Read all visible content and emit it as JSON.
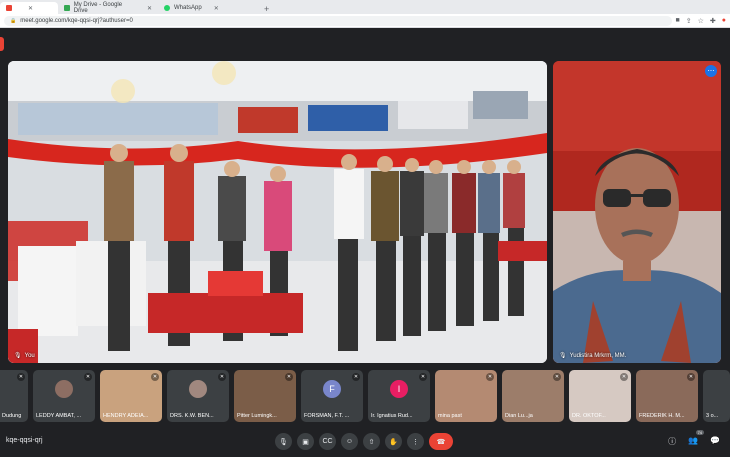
{
  "browser": {
    "tabs": [
      {
        "label": "",
        "active": true,
        "fav_color": "#ea4335"
      },
      {
        "label": "My Drive - Google Drive",
        "active": false,
        "fav_color": "#34a853"
      },
      {
        "label": "WhatsApp",
        "active": false,
        "fav_color": "#25d366"
      }
    ],
    "url": "meet.google.com/kqe-qqsi-qrj?authuser=0"
  },
  "meeting": {
    "code": "kqe-qqsi-qrj",
    "main_tile_label": "You",
    "side_tile_label": "Yudistira Mrkrm, MM.",
    "participants_count": "74",
    "thumbnails": [
      {
        "name": "Dudung",
        "avatar": "",
        "color": "#5f6368"
      },
      {
        "name": "LEDDY AMBAT, ...",
        "avatar": "",
        "color": "#5f6368"
      },
      {
        "name": "HENDRY ADEIA...",
        "avatar": "",
        "color": "#5f6368"
      },
      {
        "name": "DRS. K.W. BEN...",
        "avatar": "",
        "color": "#5f6368"
      },
      {
        "name": "Pitter Lumingk...",
        "avatar": "",
        "color": "#5f6368"
      },
      {
        "name": "FORSMAN, F.T. ...",
        "avatar": "F",
        "color": "#7986cb"
      },
      {
        "name": "Ir. Ignatius Rud...",
        "avatar": "I",
        "color": "#e91e63"
      },
      {
        "name": "mina past",
        "avatar": "",
        "color": "#5f6368"
      },
      {
        "name": "Dian Lu...ja",
        "avatar": "",
        "color": "#5f6368"
      },
      {
        "name": "DR. OKTOF...",
        "avatar": "",
        "color": "#5f6368"
      },
      {
        "name": "FREDERIK H. M...",
        "avatar": "",
        "color": "#5f6368"
      },
      {
        "name": "3 o...",
        "avatar": "",
        "color": "#5f6368"
      }
    ]
  },
  "colors": {
    "meet_bg": "#202124",
    "end_call": "#ea4335",
    "accent": "#1a73e8"
  }
}
